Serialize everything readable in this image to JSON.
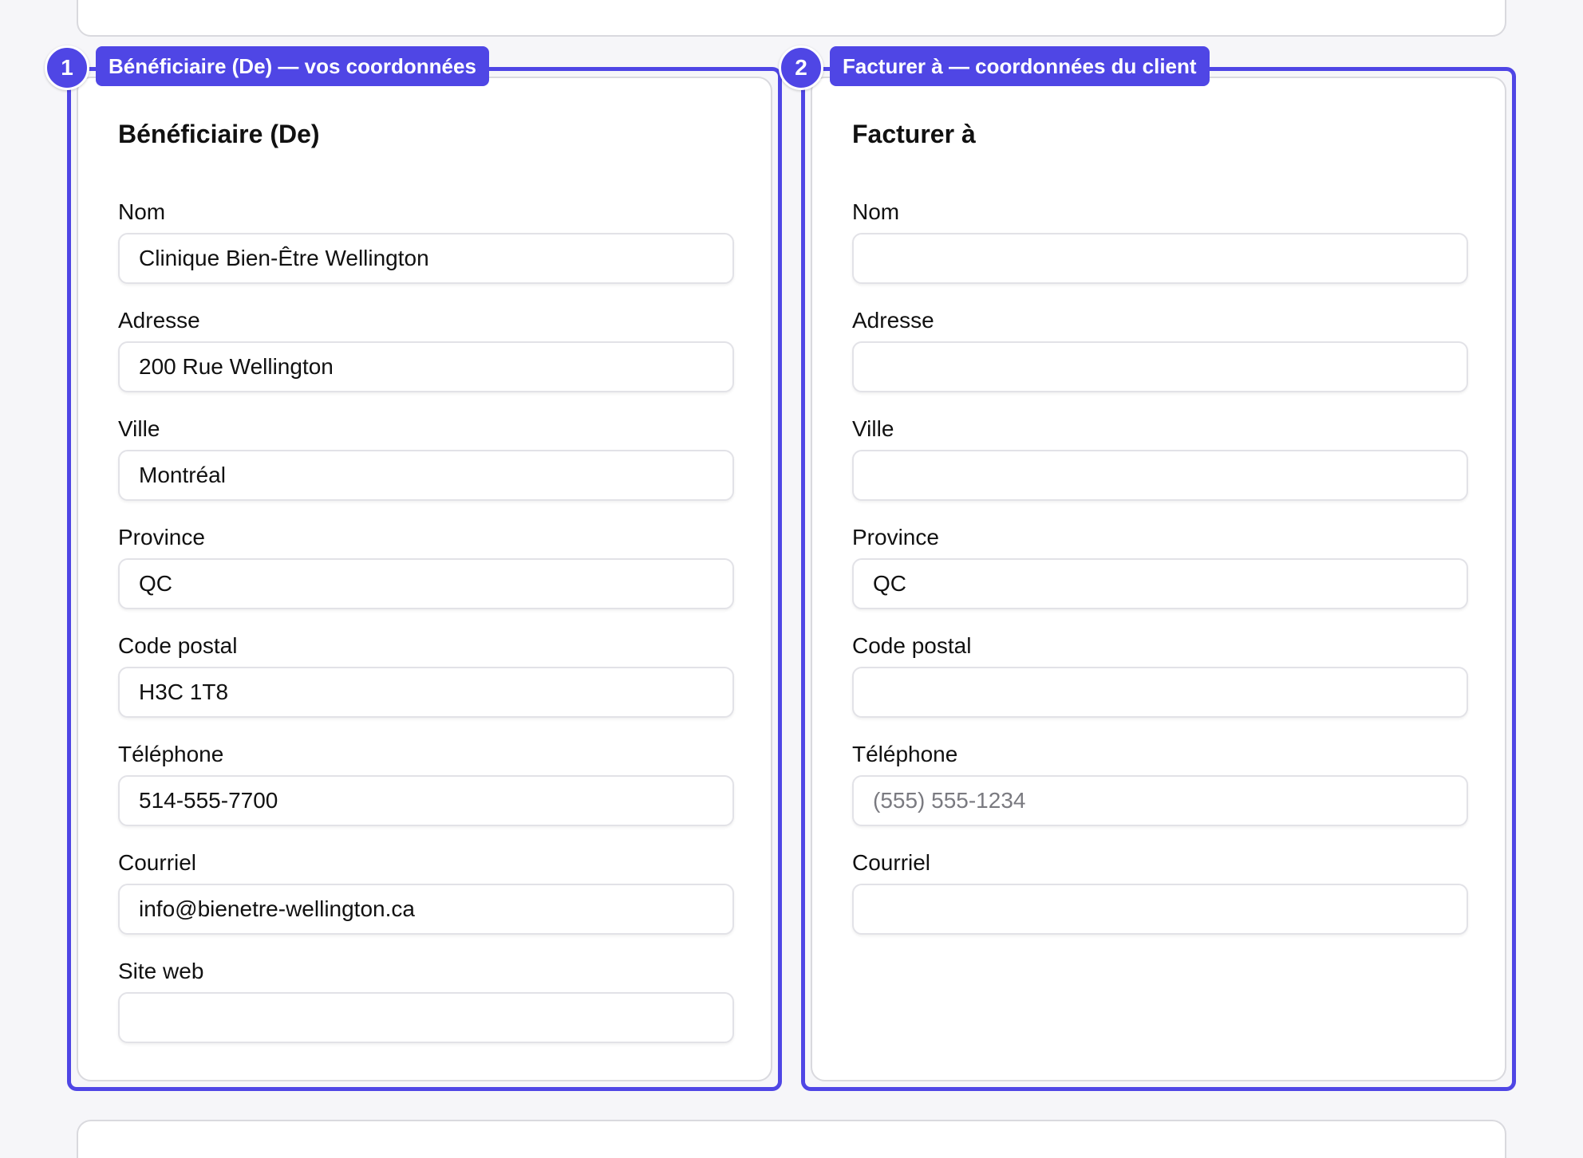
{
  "beneficiary": {
    "badge_number": "1",
    "badge_label": "Bénéficiaire (De) — vos coordonnées",
    "title": "Bénéficiaire (De)",
    "fields": [
      {
        "label": "Nom",
        "value": "Clinique Bien-Être Wellington",
        "placeholder": ""
      },
      {
        "label": "Adresse",
        "value": "200 Rue Wellington",
        "placeholder": ""
      },
      {
        "label": "Ville",
        "value": "Montréal",
        "placeholder": ""
      },
      {
        "label": "Province",
        "value": "QC",
        "placeholder": ""
      },
      {
        "label": "Code postal",
        "value": "H3C 1T8",
        "placeholder": ""
      },
      {
        "label": "Téléphone",
        "value": "514-555-7700",
        "placeholder": ""
      },
      {
        "label": "Courriel",
        "value": "info@bienetre-wellington.ca",
        "placeholder": ""
      },
      {
        "label": "Site web",
        "value": "",
        "placeholder": ""
      }
    ]
  },
  "bill_to": {
    "badge_number": "2",
    "badge_label": "Facturer à — coordonnées du client",
    "title": "Facturer à",
    "fields": [
      {
        "label": "Nom",
        "value": "",
        "placeholder": ""
      },
      {
        "label": "Adresse",
        "value": "",
        "placeholder": ""
      },
      {
        "label": "Ville",
        "value": "",
        "placeholder": ""
      },
      {
        "label": "Province",
        "value": "QC",
        "placeholder": ""
      },
      {
        "label": "Code postal",
        "value": "",
        "placeholder": ""
      },
      {
        "label": "Téléphone",
        "value": "",
        "placeholder": "(555) 555-1234"
      },
      {
        "label": "Courriel",
        "value": "",
        "placeholder": ""
      }
    ]
  },
  "colors": {
    "accent": "#4f46e5",
    "card_border": "#d9d9de",
    "background": "#f6f6f9"
  }
}
